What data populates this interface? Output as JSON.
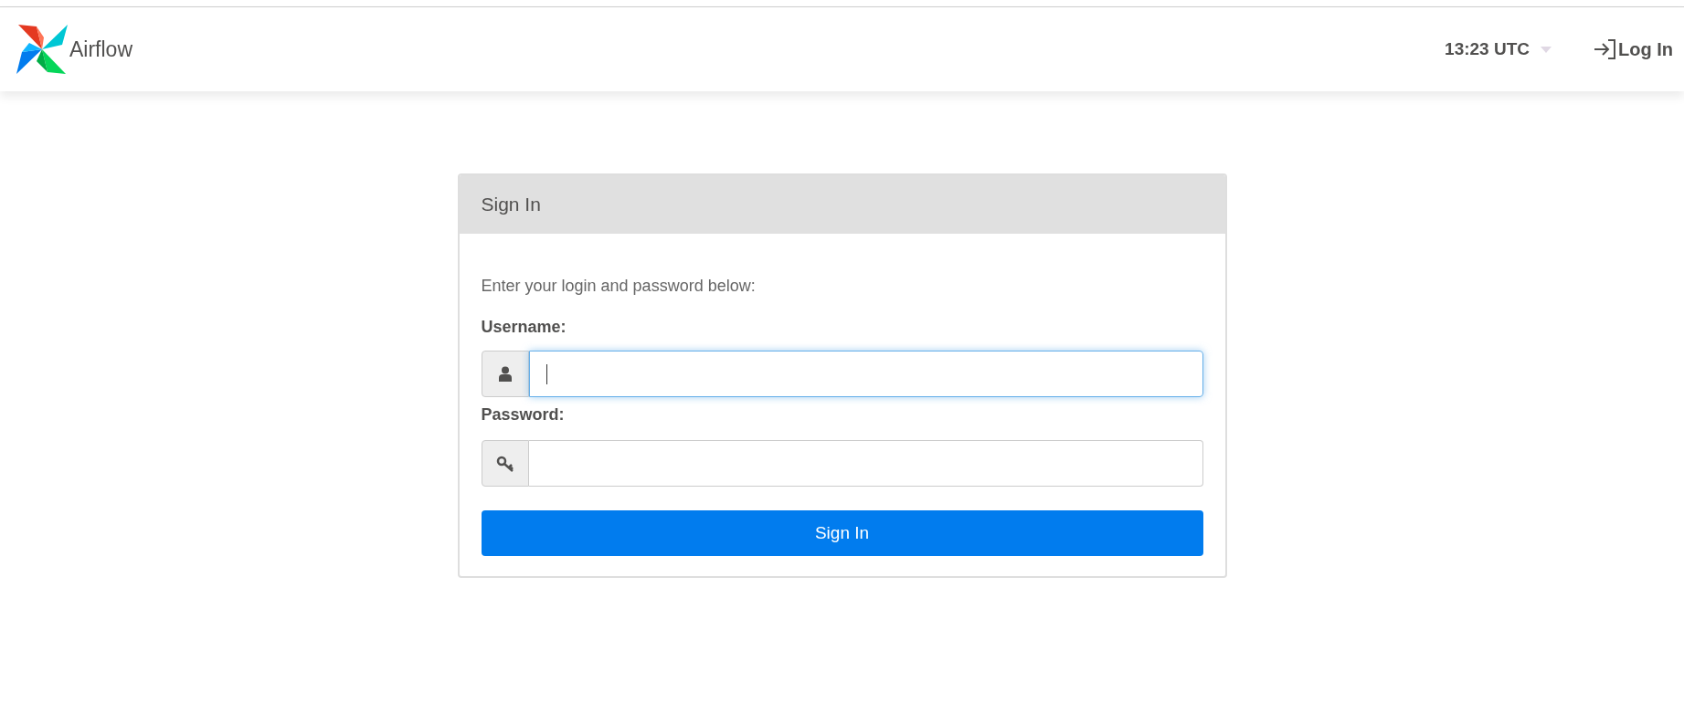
{
  "navbar": {
    "brand": "Airflow",
    "clock": "13:23 UTC",
    "login": "Log In"
  },
  "card": {
    "title": "Sign In",
    "intro": "Enter your login and password below:",
    "fields": [
      {
        "kind": "user",
        "label": "Username:",
        "focused": true
      },
      {
        "kind": "key",
        "label": "Password:",
        "focused": false
      }
    ],
    "submit": "Sign In"
  }
}
